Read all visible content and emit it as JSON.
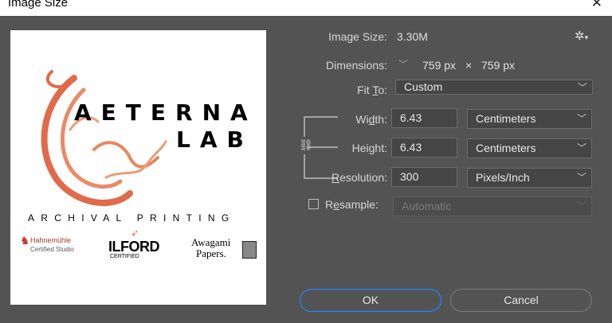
{
  "window": {
    "title": "Image Size",
    "close_icon": "close-icon"
  },
  "preview": {
    "logo_line1": "AETERNA",
    "logo_line2": "LAB",
    "tagline": "ARCHIVAL PRINTING",
    "brands": {
      "hahnemuhle": "Hahnemühle",
      "hahnemuhle_sub": "Certified Studio",
      "ilford": "ILFORD",
      "ilford_sub": "CERTIFIED",
      "awagami_1": "Awagami",
      "awagami_2": "Papers."
    },
    "logo_color": "#e06a4a"
  },
  "image_size": {
    "label": "Image Size:",
    "value": "3.30M"
  },
  "dimensions": {
    "label": "Dimensions:",
    "width": "759 px",
    "times": "×",
    "height": "759 px"
  },
  "fit_to": {
    "label": "Fit To:",
    "value": "Custom"
  },
  "width": {
    "label": "Width:",
    "value": "6.43",
    "unit": "Centimeters"
  },
  "height": {
    "label": "Height:",
    "value": "6.43",
    "unit": "Centimeters"
  },
  "resolution": {
    "label": "Resolution:",
    "value": "300",
    "unit": "Pixels/Inch"
  },
  "resample": {
    "label": "Resample:",
    "value": "Automatic",
    "checked": false
  },
  "buttons": {
    "ok": "OK",
    "cancel": "Cancel"
  },
  "colors": {
    "accent": "#3d7fd9",
    "panel": "#535353",
    "field": "#454545"
  }
}
